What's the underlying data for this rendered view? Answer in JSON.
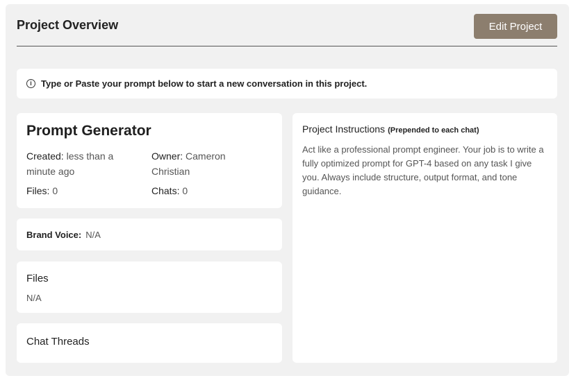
{
  "header": {
    "title": "Project Overview",
    "edit_button_label": "Edit Project"
  },
  "info_bar": {
    "icon": "info-icon",
    "text": "Type or Paste your prompt below to start a new conversation in this project."
  },
  "project": {
    "name": "Prompt Generator",
    "created_label": "Created:",
    "created_value": "less than a minute ago",
    "owner_label": "Owner:",
    "owner_value": "Cameron Christian",
    "files_label": "Files:",
    "files_value": "0",
    "chats_label": "Chats:",
    "chats_value": "0"
  },
  "brand_voice": {
    "label": "Brand Voice:",
    "value": "N/A"
  },
  "files_section": {
    "title": "Files",
    "value": "N/A"
  },
  "chat_threads": {
    "title": "Chat Threads"
  },
  "instructions": {
    "title": "Project Instructions",
    "subtitle": "(Prepended to each chat)",
    "body": "Act like a professional prompt engineer. Your job is to write a fully optimized prompt for GPT-4 based on any task I give you. Always include structure, output format, and tone guidance."
  },
  "colors": {
    "accent_button": "#8c7e6e",
    "panel_bg": "#f1f1f1",
    "card_bg": "#ffffff"
  }
}
